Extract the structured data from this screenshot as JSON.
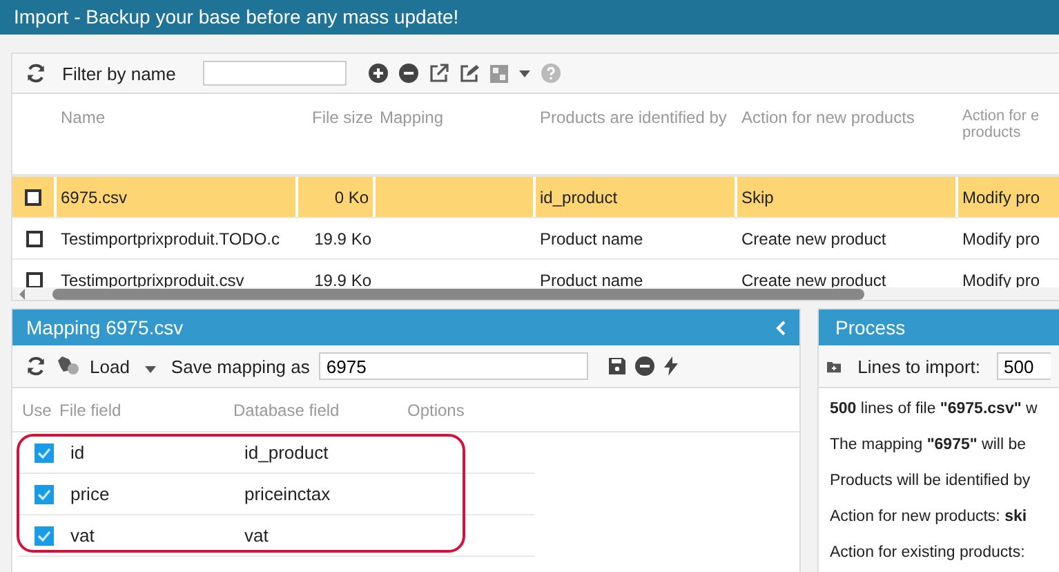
{
  "window": {
    "title": "Import - Backup your base before any mass update!"
  },
  "files": {
    "filter_label": "Filter by name",
    "columns": [
      "Name",
      "File size",
      "Mapping",
      "Products are identified by",
      "Action for new products",
      "Action for e products"
    ],
    "rows": [
      {
        "checked": false,
        "selected": true,
        "cells": [
          "6975.csv",
          "0 Ko",
          "",
          "id_product",
          "Skip",
          "Modify pro"
        ]
      },
      {
        "checked": false,
        "selected": false,
        "cells": [
          "Testimportprixproduit.TODO.c",
          "19.9 Ko",
          "",
          "Product name",
          "Create new product",
          "Modify pro"
        ]
      },
      {
        "checked": false,
        "selected": false,
        "cells": [
          "Testimportprixproduit.csv",
          "19.9 Ko",
          "",
          "Product name",
          "Create new product",
          "Modify pro"
        ]
      }
    ]
  },
  "mapping": {
    "title": "Mapping 6975.csv",
    "load_label": "Load",
    "save_label": "Save mapping as",
    "save_value": "6975",
    "columns": [
      "Use",
      "File field",
      "Database field",
      "Options"
    ],
    "rows": [
      {
        "use": true,
        "file_field": "id",
        "database_field": "id_product"
      },
      {
        "use": true,
        "file_field": "price",
        "database_field": "priceinctax"
      },
      {
        "use": true,
        "file_field": "vat",
        "database_field": "vat"
      }
    ]
  },
  "process": {
    "title": "Process",
    "lines_label": "Lines to import:",
    "lines_value": "500",
    "messages": [
      "**500** lines of file **\"6975.csv\"** w",
      "The mapping **\"6975\"** will be",
      "Products will be identified by",
      "Action for new products: **ski**",
      "Action for existing products:"
    ]
  }
}
